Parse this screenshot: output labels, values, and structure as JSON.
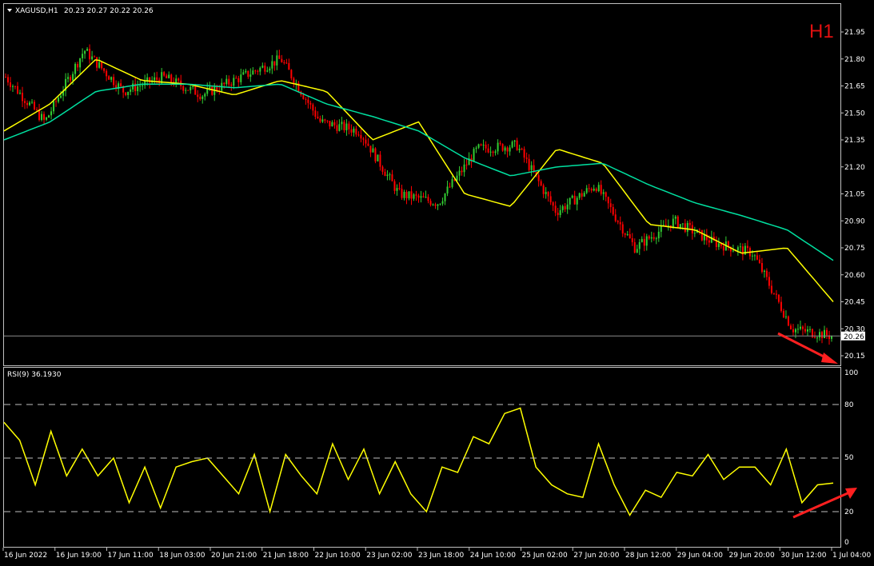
{
  "symbol_header": {
    "symbol": "XAGUSD,H1",
    "ohlc": "20.23 20.27 20.22 20.26"
  },
  "timeframe_badge": "H1",
  "price_axis": {
    "ticks": [
      "21.95",
      "21.80",
      "21.65",
      "21.50",
      "21.35",
      "21.20",
      "21.05",
      "20.90",
      "20.75",
      "20.60",
      "20.45",
      "20.30",
      "20.15"
    ],
    "last_price_label": "20.26"
  },
  "rsi_panel": {
    "label": "RSI(9) 36.1930",
    "ticks": [
      "100",
      "80",
      "50",
      "20",
      "0"
    ],
    "levels": [
      80,
      50,
      20
    ]
  },
  "time_axis": {
    "labels": [
      "16 Jun 2022",
      "16 Jun 19:00",
      "17 Jun 11:00",
      "18 Jun 03:00",
      "20 Jun 21:00",
      "21 Jun 18:00",
      "22 Jun 10:00",
      "23 Jun 02:00",
      "23 Jun 18:00",
      "24 Jun 10:00",
      "25 Jun 02:00",
      "27 Jun 20:00",
      "28 Jun 12:00",
      "29 Jun 04:00",
      "29 Jun 20:00",
      "30 Jun 12:00",
      "1 Jul 04:00"
    ]
  },
  "colors": {
    "background": "#000000",
    "bull": "#32cd32",
    "bear": "#ff0000",
    "ma_fast": "#ffff00",
    "ma_slow": "#00e0a0",
    "rsi": "#ffff00",
    "axis_text": "#ffffff",
    "annotation_arrow": "#ff2020"
  },
  "chart_data": [
    {
      "type": "line",
      "panel": "price",
      "ylim": [
        20.1,
        22.05
      ],
      "x": [
        "16 Jun 2022",
        "16 Jun 19:00",
        "17 Jun 11:00",
        "18 Jun 03:00",
        "20 Jun 21:00",
        "21 Jun 18:00",
        "22 Jun 10:00",
        "23 Jun 02:00",
        "23 Jun 18:00",
        "24 Jun 10:00",
        "25 Jun 02:00",
        "27 Jun 20:00",
        "28 Jun 12:00",
        "29 Jun 04:00",
        "29 Jun 20:00",
        "30 Jun 12:00",
        "1 Jul 04:00"
      ],
      "price_path": [
        21.7,
        21.45,
        21.85,
        21.62,
        21.7,
        21.6,
        21.7,
        21.8,
        21.45,
        21.4,
        21.05,
        21.0,
        21.3,
        21.32,
        20.95,
        21.1,
        20.75,
        20.9,
        20.78,
        20.72,
        20.3,
        20.26
      ],
      "series": [
        {
          "values": [
            21.4,
            21.55,
            21.8,
            21.68,
            21.66,
            21.6,
            21.68,
            21.62,
            21.35,
            21.45,
            21.05,
            20.98,
            21.3,
            21.22,
            20.88,
            20.85,
            20.72,
            20.75,
            20.45
          ]
        },
        {
          "values": [
            21.35,
            21.45,
            21.62,
            21.66,
            21.66,
            21.64,
            21.66,
            21.55,
            21.48,
            21.4,
            21.25,
            21.15,
            21.2,
            21.22,
            21.1,
            21.0,
            20.93,
            20.85,
            20.68
          ]
        }
      ],
      "last_price": 20.26
    },
    {
      "type": "line",
      "panel": "indicator",
      "ylim": [
        0,
        100
      ],
      "values": [
        70,
        60,
        35,
        65,
        40,
        55,
        40,
        50,
        25,
        45,
        22,
        45,
        48,
        50,
        40,
        30,
        52,
        20,
        52,
        40,
        30,
        58,
        38,
        55,
        30,
        48,
        30,
        20,
        45,
        42,
        62,
        58,
        75,
        78,
        45,
        35,
        30,
        28,
        58,
        35,
        18,
        32,
        28,
        42,
        40,
        52,
        38,
        45,
        45,
        35,
        55,
        25,
        35,
        36
      ]
    }
  ]
}
